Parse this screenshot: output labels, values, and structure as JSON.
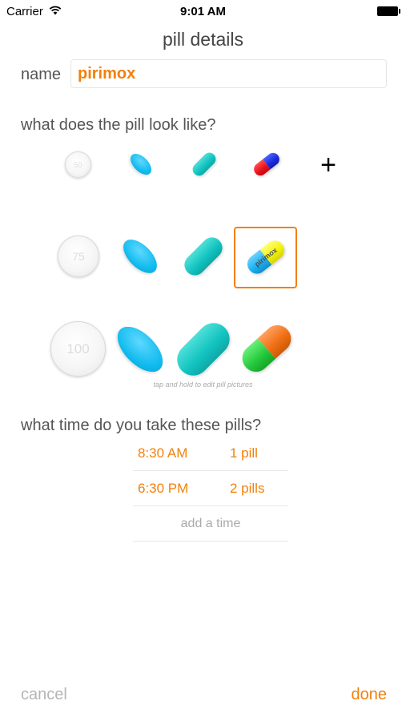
{
  "status_bar": {
    "carrier": "Carrier",
    "time": "9:01 AM",
    "wifi_icon": "wifi-icon",
    "battery_icon": "battery-icon"
  },
  "page": {
    "title": "pill details"
  },
  "name_field": {
    "label": "name",
    "value": "pirimox"
  },
  "appearance": {
    "label": "what does the pill look like?",
    "add_icon": "plus-icon",
    "round_labels": [
      "50",
      "75",
      "100"
    ],
    "capsule_label": "pirimox",
    "selected": "medium capsule",
    "hint": "tap and hold to edit pill pictures",
    "colors": {
      "accent": "#f2800b",
      "oval": "#10bbee",
      "caplet": "#12c3c0",
      "capsule_small": [
        "#e8101a",
        "#1a2ce0"
      ],
      "capsule_medium": [
        "#1aaef0",
        "#f2f20f"
      ],
      "capsule_large": [
        "#23c83a",
        "#f06e12"
      ]
    }
  },
  "schedule": {
    "label": "what time do you take these pills?",
    "times": [
      {
        "time": "8:30 AM",
        "count": "1 pill"
      },
      {
        "time": "6:30 PM",
        "count": "2 pills"
      }
    ],
    "add_time": "add a time"
  },
  "footer": {
    "cancel": "cancel",
    "done": "done"
  }
}
